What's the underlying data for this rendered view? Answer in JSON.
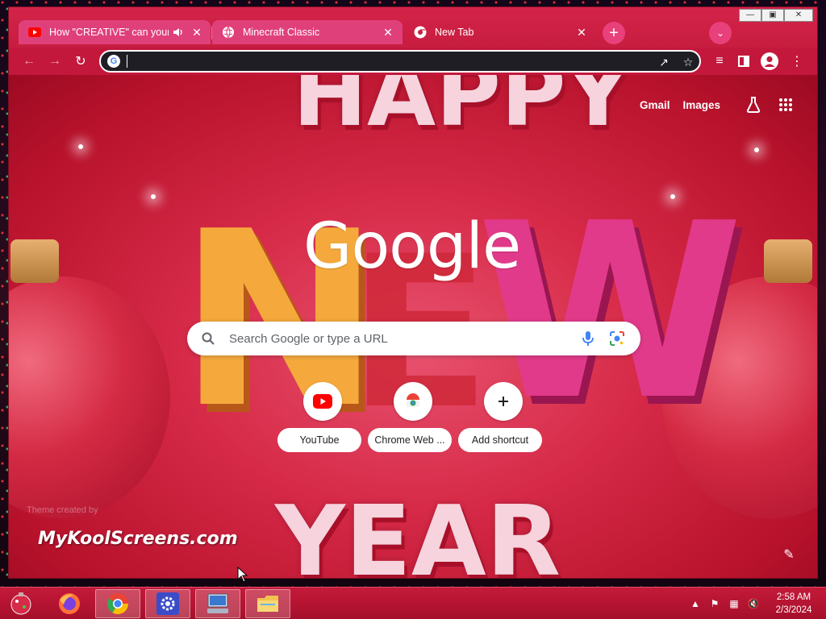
{
  "browser": {
    "tabs": [
      {
        "title": "How \"CREATIVE\" can your m",
        "favicon": "youtube-icon",
        "audio": true,
        "active": false
      },
      {
        "title": "Minecraft Classic",
        "favicon": "globe-icon",
        "active": false
      },
      {
        "title": "New Tab",
        "favicon": "chrome-icon",
        "active": true
      }
    ],
    "new_tab_symbol": "+",
    "address_value": "",
    "colors": {
      "frame": "#c71d3f",
      "tab_inactive": "#e0407a",
      "omnibox": "#1e1e24"
    }
  },
  "ntp": {
    "links": {
      "gmail": "Gmail",
      "images": "Images"
    },
    "logo": "Google",
    "search_placeholder": "Search Google or type a URL",
    "shortcuts": [
      {
        "label": "YouTube",
        "icon": "youtube-icon"
      },
      {
        "label": "Chrome Web ...",
        "icon": "chrome-web-store-icon"
      },
      {
        "label": "Add shortcut",
        "icon": "plus-icon"
      }
    ],
    "theme_credit": "Theme created by",
    "watermark": "MyKoolScreens.com"
  },
  "taskbar": {
    "apps": [
      "start-ornament-icon",
      "firefox-icon",
      "chrome-icon",
      "settings-gear-icon",
      "computer-icon",
      "file-explorer-icon"
    ],
    "clock_time": "2:58 AM",
    "clock_date": "2/3/2024"
  }
}
